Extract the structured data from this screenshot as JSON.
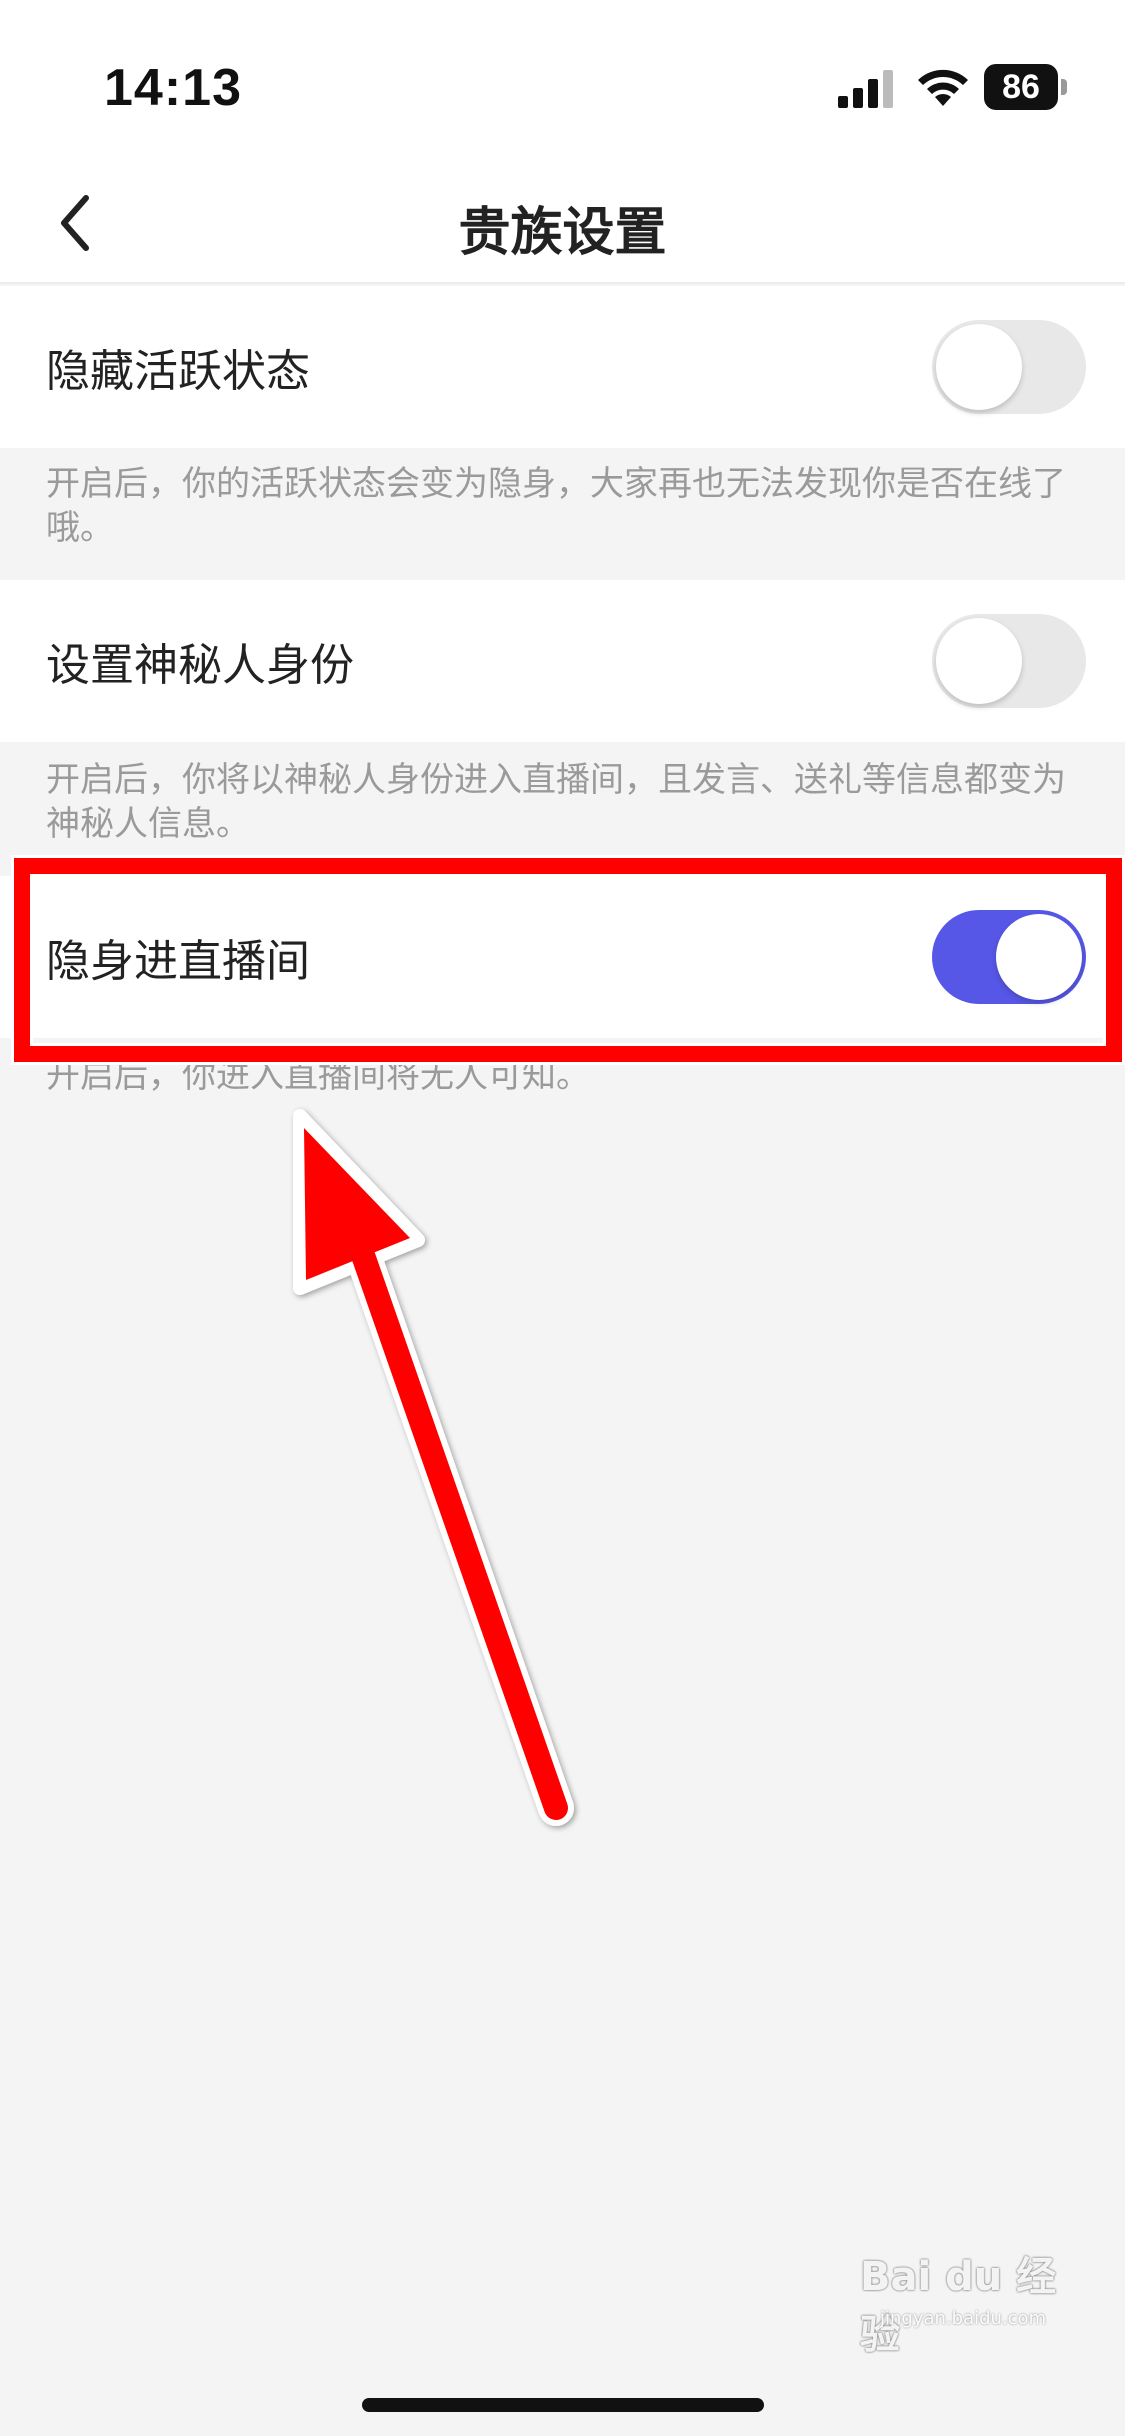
{
  "status_bar": {
    "time": "14:13",
    "battery": "86",
    "icons": [
      "cellular-signal-icon",
      "wifi-icon",
      "battery-icon"
    ]
  },
  "nav": {
    "title": "贵族设置",
    "back_icon": "chevron-left-icon"
  },
  "settings": [
    {
      "label": "隐藏活跃状态",
      "enabled": false,
      "description": "开启后，你的活跃状态会变为隐身，大家再也无法发现你是否在线了哦。"
    },
    {
      "label": "设置神秘人身份",
      "enabled": false,
      "description": "开启后，你将以神秘人身份进入直播间，且发言、送礼等信息都变为神秘人信息。"
    },
    {
      "label": "隐身进直播间",
      "enabled": true,
      "description": "开启后，你进入直播间将无人可知。"
    }
  ],
  "colors": {
    "toggle_on": "#5757e7",
    "toggle_off": "#e8e8e8",
    "highlight": "#ff0000",
    "background": "#f4f4f4"
  },
  "watermark": {
    "brand": "Bai du 经验",
    "url": "jingyan.baidu.com"
  }
}
